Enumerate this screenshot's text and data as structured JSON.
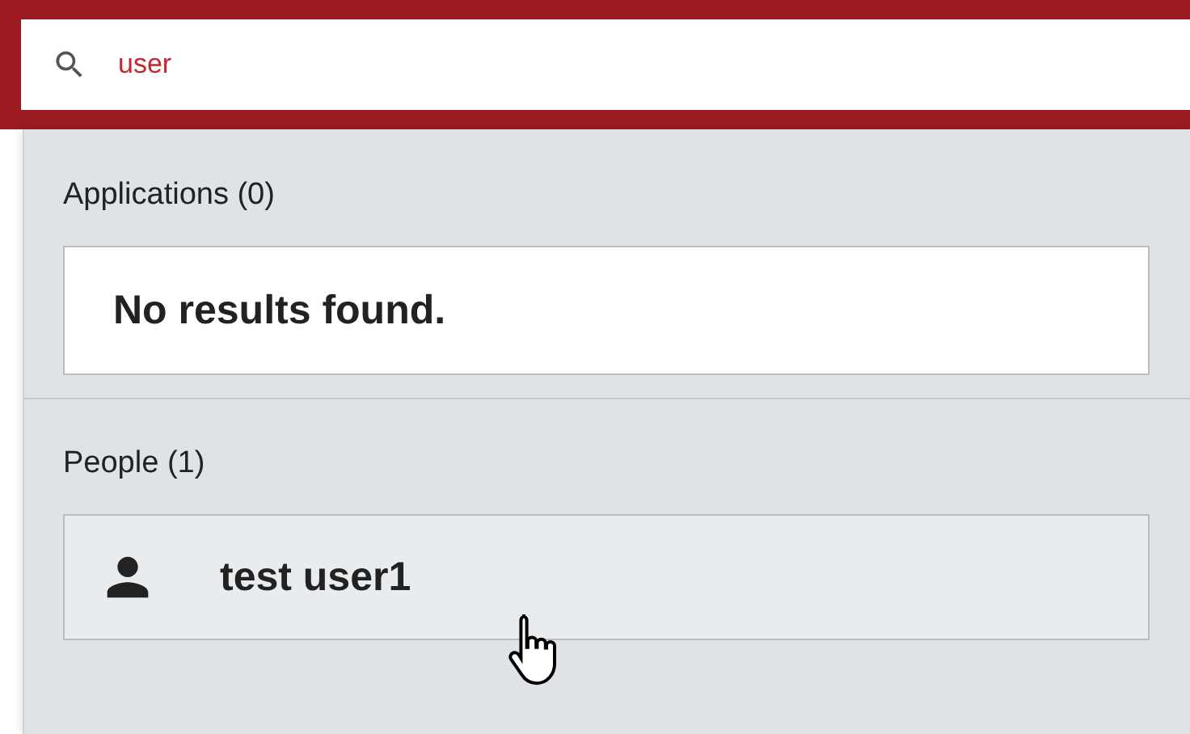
{
  "search": {
    "value": "user"
  },
  "sections": [
    {
      "title": "Applications (0)",
      "kind": "empty",
      "message": "No results found."
    },
    {
      "title": "People (1)",
      "kind": "people",
      "results": [
        {
          "name": "test user1"
        }
      ]
    }
  ]
}
